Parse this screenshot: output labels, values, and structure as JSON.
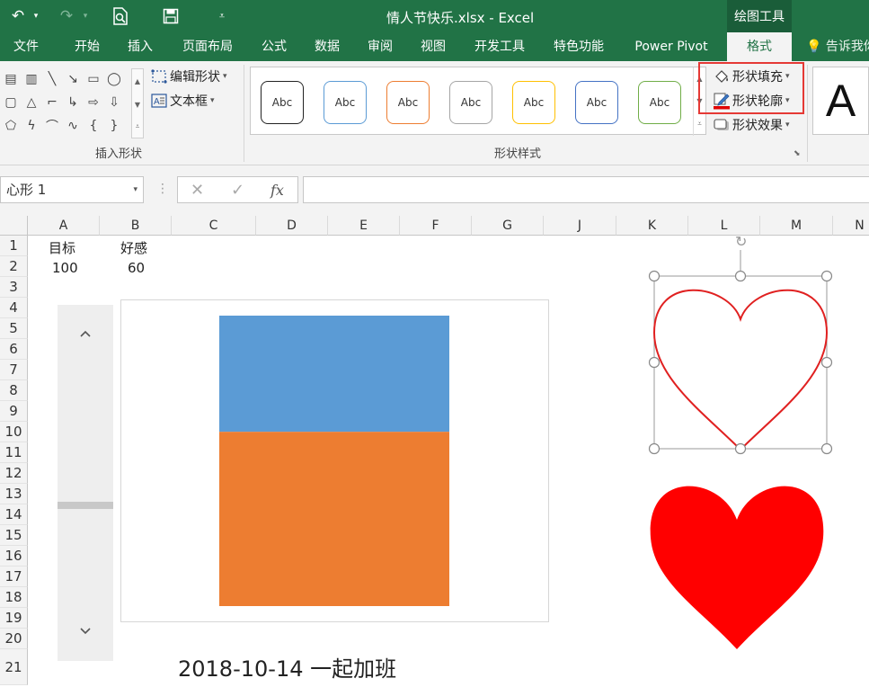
{
  "window": {
    "title": "情人节快乐.xlsx - Excel",
    "context_tab": "绘图工具"
  },
  "quick_access": [
    "undo-icon",
    "redo-icon",
    "print-preview-icon",
    "save-icon",
    "customize-icon"
  ],
  "tabs": [
    {
      "label": "文件"
    },
    {
      "label": "开始"
    },
    {
      "label": "插入"
    },
    {
      "label": "页面布局"
    },
    {
      "label": "公式"
    },
    {
      "label": "数据"
    },
    {
      "label": "审阅"
    },
    {
      "label": "视图"
    },
    {
      "label": "开发工具"
    },
    {
      "label": "特色功能"
    },
    {
      "label": "Power Pivot"
    },
    {
      "label": "格式",
      "active": true
    }
  ],
  "tell_me": "告诉我你",
  "ribbon": {
    "insert_shapes": {
      "label": "插入形状",
      "edit_shape": "编辑形状",
      "text_box": "文本框"
    },
    "shape_styles": {
      "label": "形状样式",
      "preset_text": "Abc",
      "presets": [
        {
          "border": "#222222"
        },
        {
          "border": "#5b9bd5"
        },
        {
          "border": "#ed7d31"
        },
        {
          "border": "#a5a5a5"
        },
        {
          "border": "#ffc000"
        },
        {
          "border": "#4472c4"
        },
        {
          "border": "#70ad47"
        }
      ],
      "fill": "形状填充",
      "outline": "形状轮廓",
      "effects": "形状效果"
    },
    "wordart_glyph": "A"
  },
  "formula_bar": {
    "name_box": "心形 1",
    "cancel": "✕",
    "enter": "✓",
    "fx": "fx",
    "value": ""
  },
  "columns": [
    "A",
    "B",
    "C",
    "D",
    "E",
    "F",
    "G",
    "J",
    "K",
    "L",
    "M",
    "N"
  ],
  "rows": [
    "1",
    "2",
    "3",
    "4",
    "5",
    "6",
    "7",
    "8",
    "9",
    "10",
    "11",
    "12",
    "13",
    "14",
    "15",
    "16",
    "17",
    "18",
    "19",
    "20",
    "21"
  ],
  "cells": {
    "A1": "目标",
    "B1": "好感",
    "A2": "100",
    "B2": "60"
  },
  "chart_data": {
    "type": "bar",
    "stacked": true,
    "categories": [
      ""
    ],
    "series": [
      {
        "values": [
          40
        ],
        "color": "#5b9bd5"
      },
      {
        "values": [
          60
        ],
        "color": "#ed7d31"
      }
    ],
    "ylim": [
      0,
      100
    ],
    "grid": false,
    "legend": "none"
  },
  "shapes": {
    "outlined_heart": {
      "stroke": "#e02020",
      "selected": true
    },
    "filled_heart": {
      "fill": "#ff0000"
    }
  },
  "date_text": "2018-10-14 一起加班"
}
